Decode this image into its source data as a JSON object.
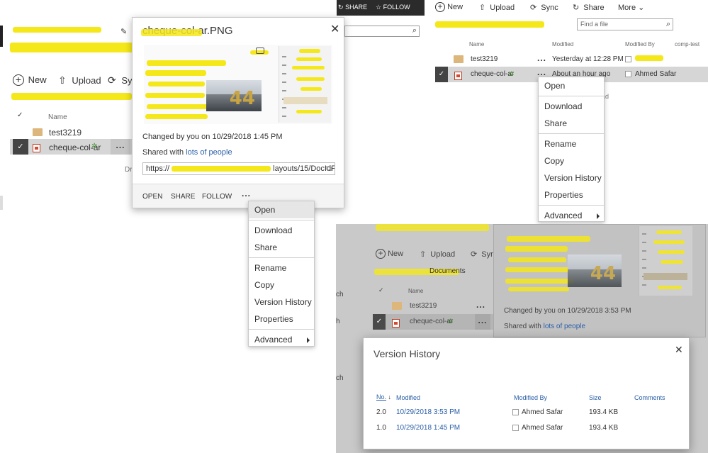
{
  "left": {
    "toolbar": {
      "new_label": "New",
      "upload_label": "Upload",
      "sync_label": "Syn"
    },
    "columns": {
      "name": "Name"
    },
    "rows": [
      {
        "name": "test3219"
      },
      {
        "name": "cheque-col-ar"
      }
    ],
    "drag_hint": "Dra"
  },
  "callout": {
    "title": "cheque-col-ar.PNG",
    "changed": "Changed by you on 10/29/2018 1:45 PM",
    "shared_prefix": "Shared with",
    "shared_link": "lots of people",
    "url": "https://",
    "url_suffix": "layouts/15/DocIdF",
    "actions": {
      "open": "OPEN",
      "share": "SHARE",
      "follow": "FOLLOW",
      "more": "..."
    },
    "image_text": "44"
  },
  "menu1": {
    "items": [
      "Open",
      "Download",
      "Share",
      "Rename",
      "Copy",
      "Version History",
      "Properties",
      "Advanced"
    ]
  },
  "top_right": {
    "topbar": {
      "share": "SHARE",
      "follow": "FOLLOW"
    },
    "toolbar": {
      "new_label": "New",
      "upload_label": "Upload",
      "sync_label": "Sync",
      "share_label": "Share",
      "more_label": "More"
    },
    "search_placeholder": "Find a file",
    "columns": {
      "name": "Name",
      "modified": "Modified",
      "modified_by": "Modified By",
      "extra": "comp-test"
    },
    "rows": [
      {
        "name": "test3219",
        "modified": "Yesterday at 12:28 PM",
        "modified_by": ""
      },
      {
        "name": "cheque-col-ar",
        "modified": "About an hour ago",
        "modified_by": "Ahmed Safar"
      }
    ],
    "clipped_text": "oad"
  },
  "menu2": {
    "items": [
      "Open",
      "Download",
      "Share",
      "Rename",
      "Copy",
      "Version History",
      "Properties",
      "Advanced"
    ]
  },
  "bottom_right": {
    "toolbar": {
      "new_label": "New",
      "upload_label": "Upload",
      "sync_label": "Syn"
    },
    "header_text": "Documents",
    "columns": {
      "name": "Name"
    },
    "rows": [
      {
        "name": "test3219"
      },
      {
        "name": "cheque-col-ar"
      }
    ],
    "side_letters": [
      "ch",
      "h",
      "ch"
    ],
    "callout": {
      "changed": "Changed by you on 10/29/2018 3:53 PM",
      "shared_prefix": "Shared with",
      "shared_link": "lots of people",
      "image_text": "44"
    }
  },
  "version_history": {
    "title": "Version History",
    "columns": {
      "no": "No.",
      "sort": "↓",
      "modified": "Modified",
      "modified_by": "Modified By",
      "size": "Size",
      "comments": "Comments"
    },
    "rows": [
      {
        "no": "2.0",
        "modified": "10/29/2018 3:53 PM",
        "modified_by": "Ahmed Safar",
        "size": "193.4 KB"
      },
      {
        "no": "1.0",
        "modified": "10/29/2018 1:45 PM",
        "modified_by": "Ahmed Safar",
        "size": "193.4 KB"
      }
    ]
  },
  "colors": {
    "highlight": "#f5e81a",
    "link": "#2a5fa8",
    "topbar": "#2b2b2b",
    "overlay": "#c9c9c9"
  }
}
